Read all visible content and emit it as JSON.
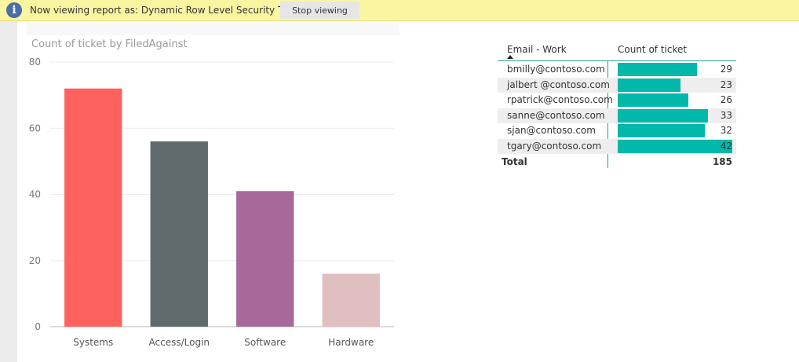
{
  "banner": {
    "message": "Now viewing report as: Dynamic Row Level Security Test",
    "stop_label": "Stop viewing",
    "info_glyph": "i",
    "icon": "info-icon"
  },
  "chart_data": {
    "type": "bar",
    "title": "Count of ticket by FiledAgainst",
    "xlabel": "",
    "ylabel": "",
    "categories": [
      "Systems",
      "Access/Login",
      "Software",
      "Hardware"
    ],
    "values": [
      72,
      56,
      41,
      16
    ],
    "colors": [
      "#fd625e",
      "#5f6b6d",
      "#a66999",
      "#dfbfbf"
    ],
    "ylim": [
      0,
      80
    ],
    "yticks": [
      0,
      20,
      40,
      60,
      80
    ],
    "grid": true
  },
  "table": {
    "headers": [
      "Email - Work",
      "Count of ticket"
    ],
    "sort_indicator": "ascending",
    "bar_color": "#01b8aa",
    "rows": [
      {
        "email": "bmilly@contoso.com",
        "count": 29
      },
      {
        "email": "jalbert @contoso.com",
        "count": 23
      },
      {
        "email": "rpatrick@contoso.com",
        "count": 26
      },
      {
        "email": "sanne@contoso.com",
        "count": 33
      },
      {
        "email": "sjan@contoso.com",
        "count": 32
      },
      {
        "email": "tgary@contoso.com",
        "count": 42
      }
    ],
    "total_label": "Total",
    "total_value": 185
  }
}
